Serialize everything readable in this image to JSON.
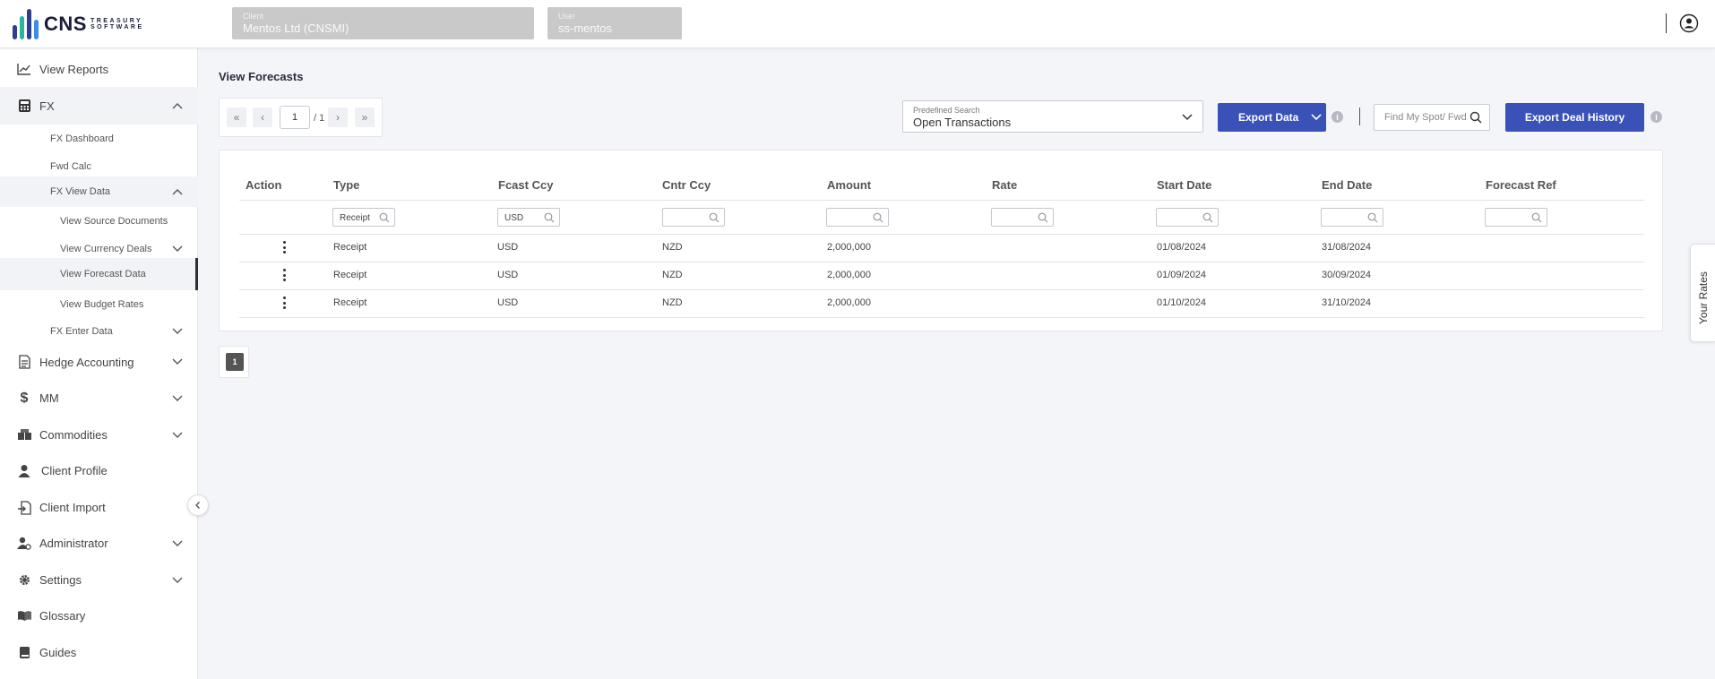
{
  "brand": {
    "name": "CNS",
    "tagline_1": "TREASURY",
    "tagline_2": "SOFTWARE",
    "bar_colors": [
      "#2d3e8f",
      "#2bb59a",
      "#2d3e8f",
      "#3a8ee6"
    ]
  },
  "header": {
    "client_label": "Client",
    "client_value": "Mentos Ltd (CNSMI)",
    "user_label": "User",
    "user_value": "ss-mentos"
  },
  "sidebar": {
    "view_reports": "View Reports",
    "fx": "FX",
    "fx_dashboard": "FX Dashboard",
    "fwd_calc": "Fwd Calc",
    "fx_view_data": "FX View Data",
    "view_source_documents": "View Source Documents",
    "view_currency_deals": "View Currency Deals",
    "view_forecast_data": "View Forecast Data",
    "view_budget_rates": "View Budget Rates",
    "fx_enter_data": "FX Enter Data",
    "hedge_accounting": "Hedge Accounting",
    "mm": "MM",
    "commodities": "Commodities",
    "client_profile": "Client Profile",
    "client_import": "Client Import",
    "administrator": "Administrator",
    "settings": "Settings",
    "glossary": "Glossary",
    "guides": "Guides"
  },
  "main": {
    "title": "View Forecasts",
    "pager": {
      "current": "1",
      "total": "/ 1",
      "first": "«",
      "prev": "‹",
      "next": "›",
      "last": "»"
    },
    "predefined_search": {
      "label": "Predefined Search",
      "value": "Open Transactions"
    },
    "export_data": "Export Data",
    "find_placeholder": "Find My Spot/ Fwd",
    "export_deal_history": "Export Deal History",
    "accent_color": "#3a51b8",
    "table": {
      "columns": [
        "Action",
        "Type",
        "Fcast Ccy",
        "Cntr Ccy",
        "Amount",
        "Rate",
        "Start Date",
        "End Date",
        "Forecast Ref"
      ],
      "filters": [
        "",
        "Receipt",
        "USD",
        "",
        "",
        "",
        "",
        "",
        ""
      ],
      "rows": [
        {
          "type": "Receipt",
          "fcast_ccy": "USD",
          "cntr_ccy": "NZD",
          "amount": "2,000,000",
          "rate": "",
          "start_date": "01/08/2024",
          "end_date": "31/08/2024",
          "forecast_ref": ""
        },
        {
          "type": "Receipt",
          "fcast_ccy": "USD",
          "cntr_ccy": "NZD",
          "amount": "2,000,000",
          "rate": "",
          "start_date": "01/09/2024",
          "end_date": "30/09/2024",
          "forecast_ref": ""
        },
        {
          "type": "Receipt",
          "fcast_ccy": "USD",
          "cntr_ccy": "NZD",
          "amount": "2,000,000",
          "rate": "",
          "start_date": "01/10/2024",
          "end_date": "31/10/2024",
          "forecast_ref": ""
        }
      ]
    },
    "bottom_page": "1"
  },
  "rates_tab": "Your Rates"
}
